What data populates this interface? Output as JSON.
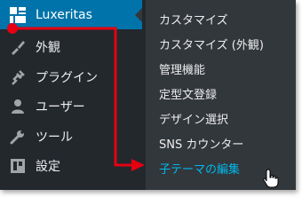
{
  "menu": {
    "items": [
      {
        "label": "Luxeritas",
        "icon": "grid-icon",
        "active": true
      },
      {
        "label": "外観",
        "icon": "paintbrush-icon"
      },
      {
        "label": "プラグイン",
        "icon": "plugin-icon"
      },
      {
        "label": "ユーザー",
        "icon": "user-icon"
      },
      {
        "label": "ツール",
        "icon": "wrench-icon"
      },
      {
        "label": "設定",
        "icon": "settings-icon"
      }
    ]
  },
  "submenu": {
    "items": [
      {
        "label": "カスタマイズ"
      },
      {
        "label": "カスタマイズ (外観)"
      },
      {
        "label": "管理機能"
      },
      {
        "label": "定型文登録"
      },
      {
        "label": "デザイン選択"
      },
      {
        "label": "SNS カウンター"
      },
      {
        "label": "子テーマの編集",
        "highlight": true
      }
    ]
  },
  "colors": {
    "menu_bg": "#23282d",
    "submenu_bg": "#32373c",
    "active_bg": "#0073aa",
    "highlight_text": "#00b9eb",
    "annotation": "#e60012"
  }
}
